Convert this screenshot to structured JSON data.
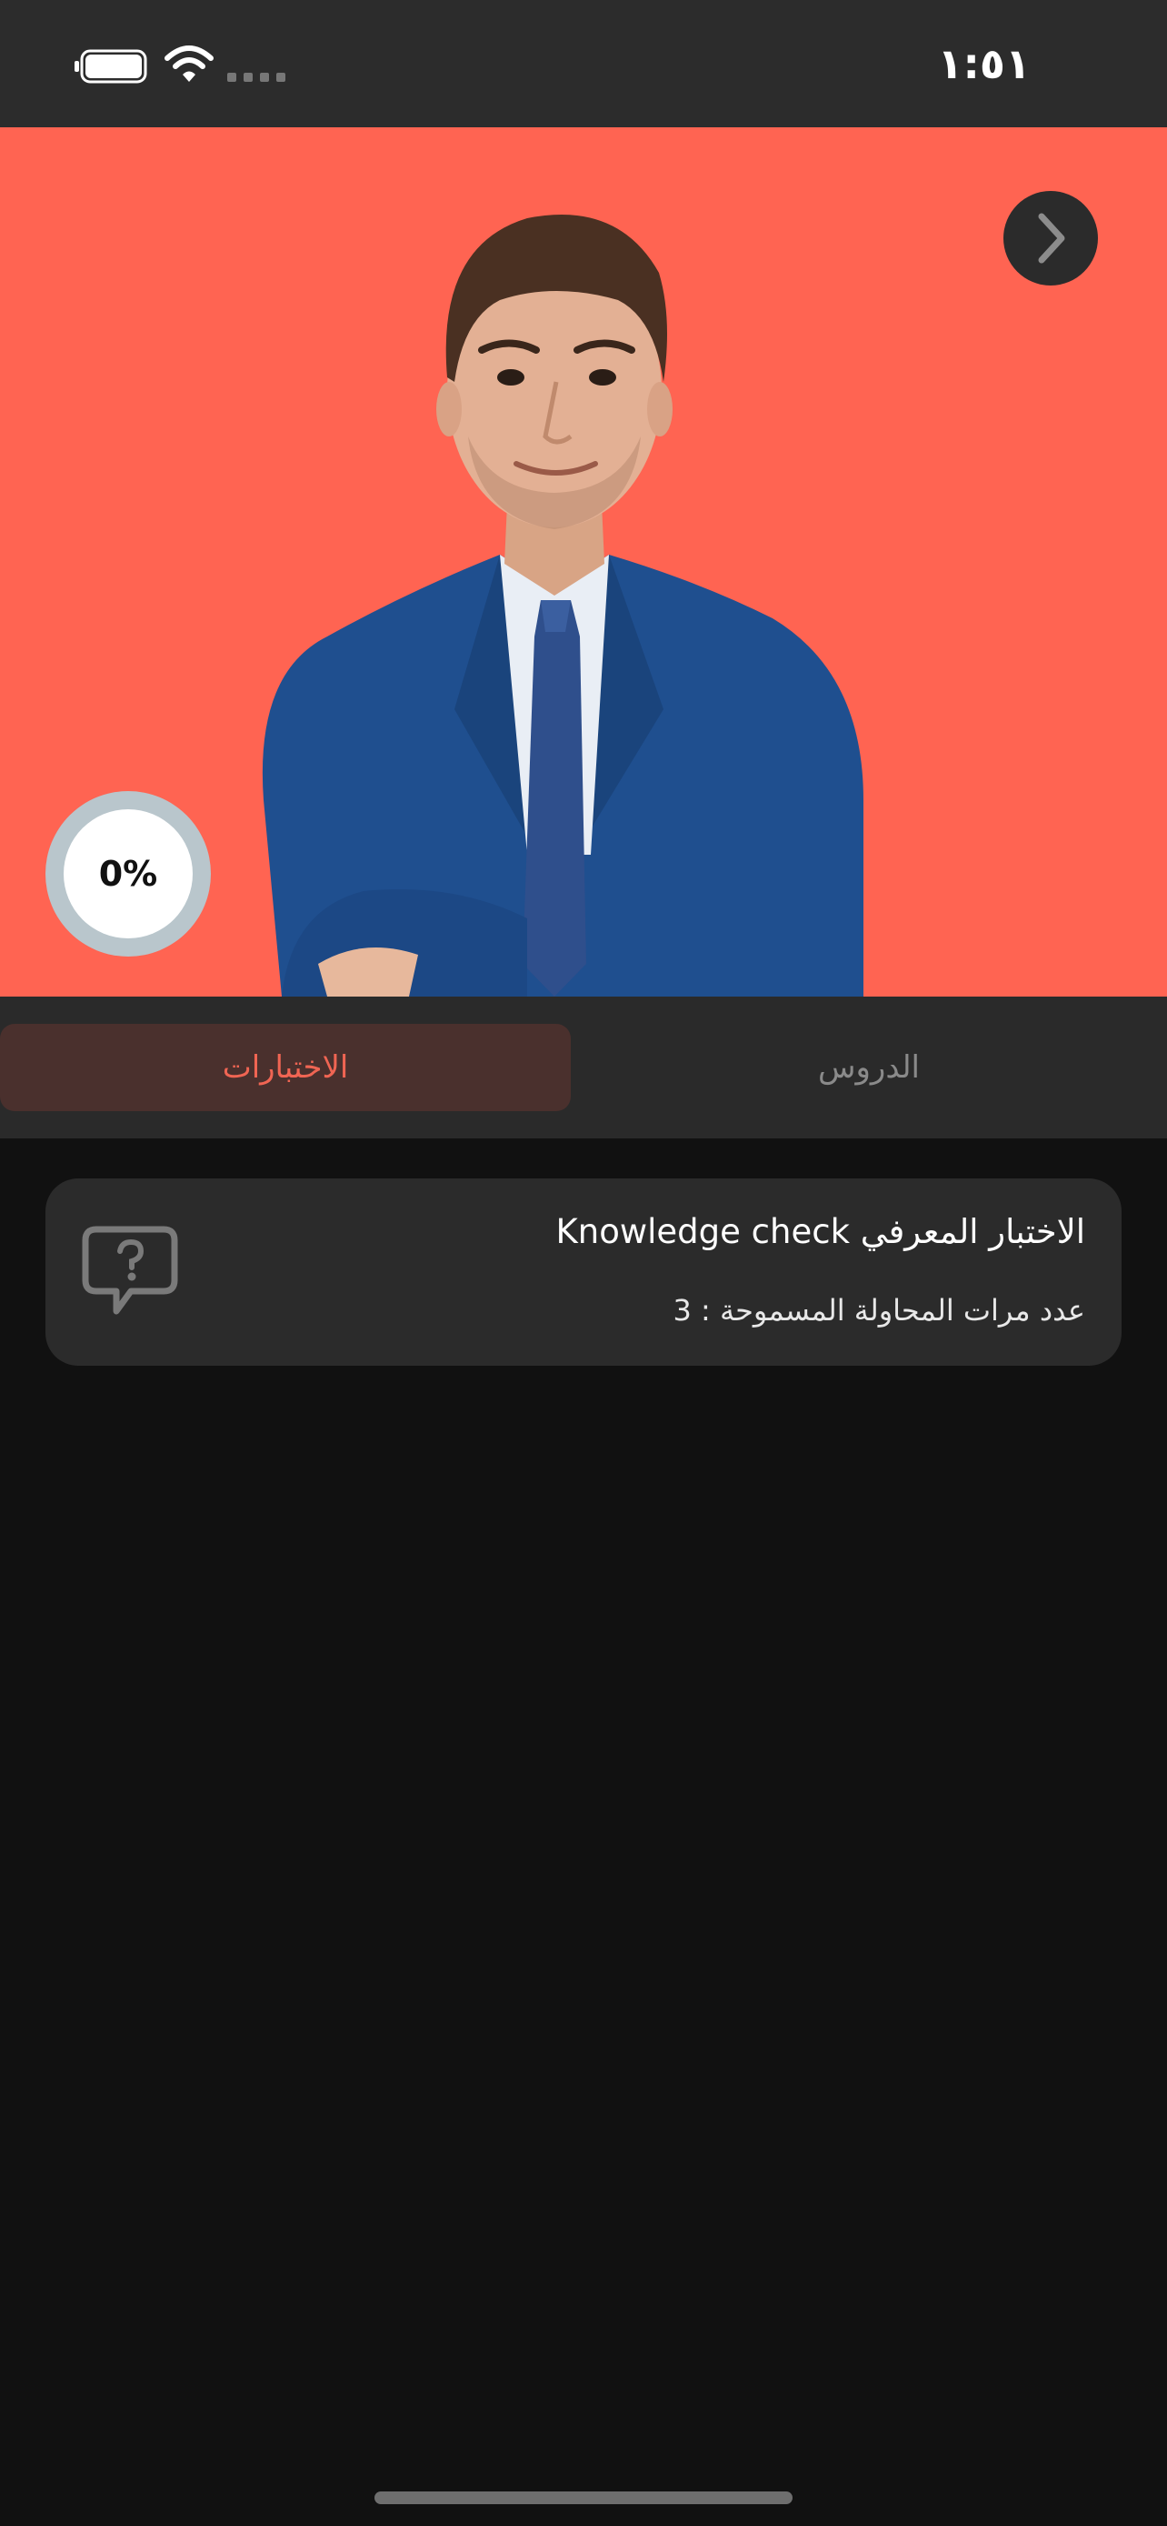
{
  "status_bar": {
    "time": "١:٥١",
    "icons": [
      "battery-icon",
      "wifi-icon",
      "cellular-signal-icon"
    ]
  },
  "hero": {
    "image": "presenter-photo",
    "background_color": "#ff6452",
    "progress": {
      "label": "0%",
      "value": 0
    },
    "next_icon": "chevron-right-icon"
  },
  "tabs": {
    "items": [
      {
        "label": "الاختبارات",
        "active": true
      },
      {
        "label": "الدروس",
        "active": false
      }
    ],
    "active_color": "#f06553"
  },
  "quiz_list": [
    {
      "title": "الاختبار المعرفي Knowledge check",
      "attempts": "عدد مرات المحاولة المسموحة : 3",
      "icon": "question-bubble-icon"
    }
  ]
}
